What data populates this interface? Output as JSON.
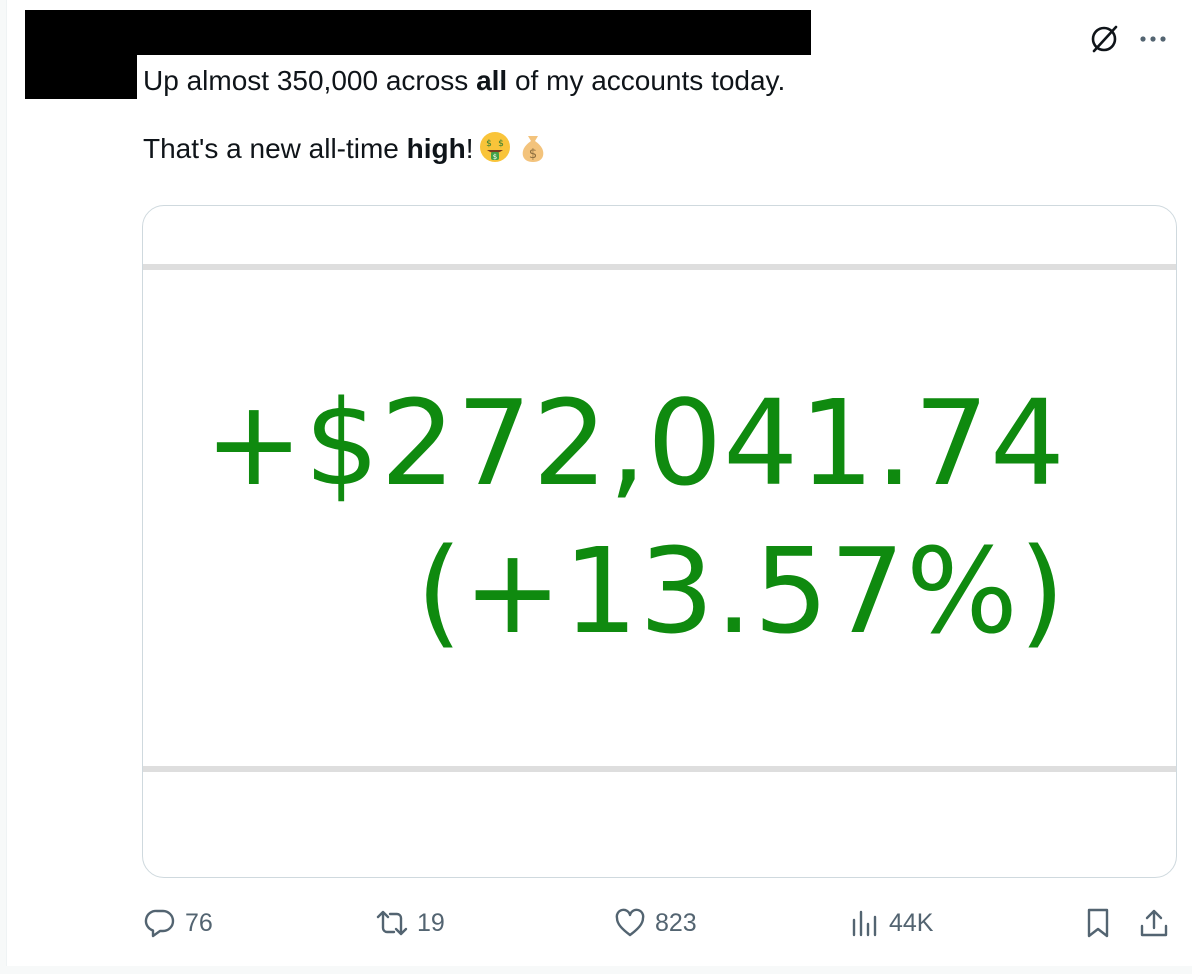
{
  "tweet": {
    "line1_pre": "Up almost 350,000 across ",
    "line1_bold": "all",
    "line1_post": " of my accounts today.",
    "line2_pre": "That's a new all-time ",
    "line2_bold": "high",
    "line2_post": "!"
  },
  "media": {
    "gain_amount": "+$272,041.74",
    "gain_percent": "(+13.57%)",
    "gain_color": "#0f8a0f"
  },
  "actions": {
    "replies": "76",
    "retweets": "19",
    "likes": "823",
    "views": "44K"
  },
  "icons": {
    "emoji_1": "money-mouth-face-icon",
    "emoji_2": "money-bag-icon",
    "top_right": [
      "grok-icon",
      "more-icon"
    ],
    "action_bar": [
      "reply-icon",
      "retweet-icon",
      "like-icon",
      "views-icon",
      "bookmark-icon",
      "share-icon"
    ]
  },
  "colors": {
    "text": "#0f1419",
    "muted": "#536471",
    "border": "#cfd9de",
    "background": "#ffffff"
  }
}
